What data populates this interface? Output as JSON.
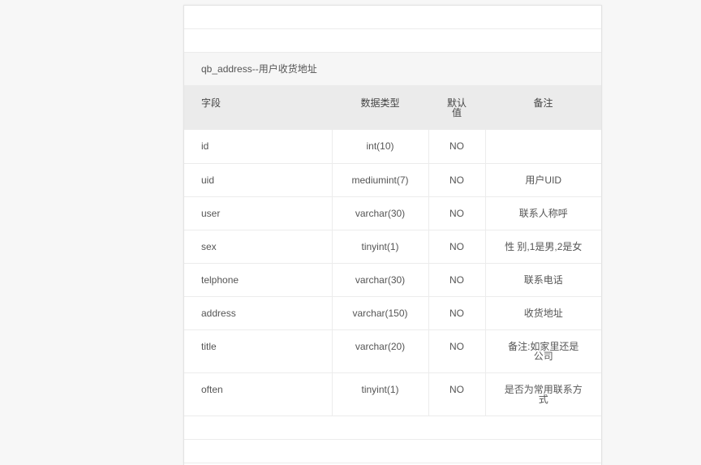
{
  "caption": "qb_address--用户收货地址",
  "columns": [
    "字段",
    "数据类型",
    "默认值",
    "备注"
  ],
  "rows": [
    {
      "field": "id",
      "type": "int(10)",
      "default": "NO",
      "note": ""
    },
    {
      "field": "uid",
      "type": "mediumint(7)",
      "default": "NO",
      "note": "用户UID"
    },
    {
      "field": "user",
      "type": "varchar(30)",
      "default": "NO",
      "note": "联系人称呼"
    },
    {
      "field": "sex",
      "type": "tinyint(1)",
      "default": "NO",
      "note": "性 别,1是男,2是女"
    },
    {
      "field": "telphone",
      "type": "varchar(30)",
      "default": "NO",
      "note": "联系电话"
    },
    {
      "field": "address",
      "type": "varchar(150)",
      "default": "NO",
      "note": "收货地址"
    },
    {
      "field": "title",
      "type": "varchar(20)",
      "default": "NO",
      "note": "备注:如家里还是公司"
    },
    {
      "field": "often",
      "type": "tinyint(1)",
      "default": "NO",
      "note": "是否为常用联系方式"
    }
  ]
}
